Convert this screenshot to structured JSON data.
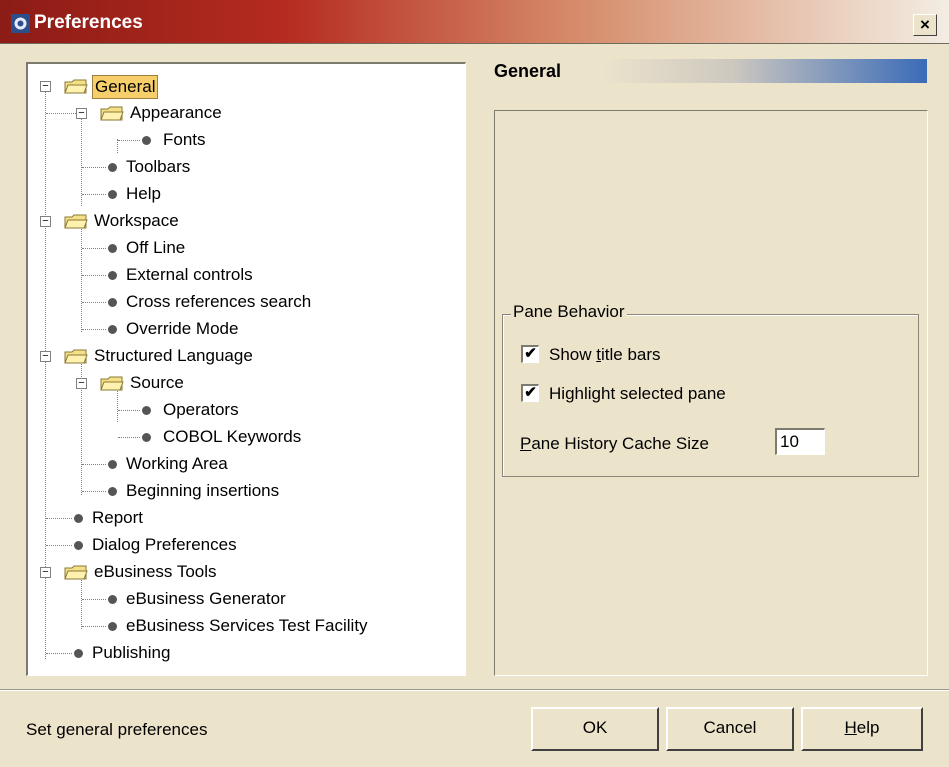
{
  "window": {
    "title": "Preferences",
    "close_label": "×"
  },
  "tree": {
    "items": [
      {
        "label": "General",
        "selected": true
      },
      {
        "label": "Appearance"
      },
      {
        "label": "Fonts"
      },
      {
        "label": "Toolbars"
      },
      {
        "label": "Help"
      },
      {
        "label": "Workspace"
      },
      {
        "label": "Off Line"
      },
      {
        "label": "External controls"
      },
      {
        "label": "Cross references search"
      },
      {
        "label": "Override Mode"
      },
      {
        "label": "Structured Language"
      },
      {
        "label": "Source"
      },
      {
        "label": "Operators"
      },
      {
        "label": "COBOL Keywords"
      },
      {
        "label": "Working Area"
      },
      {
        "label": "Beginning insertions"
      },
      {
        "label": "Report"
      },
      {
        "label": "Dialog Preferences"
      },
      {
        "label": "eBusiness Tools"
      },
      {
        "label": "eBusiness Generator"
      },
      {
        "label": "eBusiness Services Test Facility"
      },
      {
        "label": "Publishing"
      }
    ]
  },
  "section": {
    "title": "General"
  },
  "pane_behavior": {
    "group_title": "Pane Behavior",
    "show_title_bars": {
      "label_pre": "Show ",
      "label_mnemonic": "t",
      "label_post": "itle bars",
      "checked": true
    },
    "highlight_selected_pane": {
      "label_pre": "Hi",
      "label_mnemonic": "g",
      "label_post": "hlight selected pane",
      "checked": true
    },
    "cache_size": {
      "label_mnemonic": "P",
      "label_post": "ane History Cache Size",
      "value": "10"
    }
  },
  "status_text": "Set general preferences",
  "buttons": {
    "ok": "OK",
    "cancel": "Cancel",
    "help_mnemonic": "H",
    "help_post": "elp"
  },
  "colors": {
    "background": "#ece3cb",
    "selection": "#f7cf6a",
    "title_start": "#8c1c16",
    "header_accent": "#3a6bb8"
  }
}
